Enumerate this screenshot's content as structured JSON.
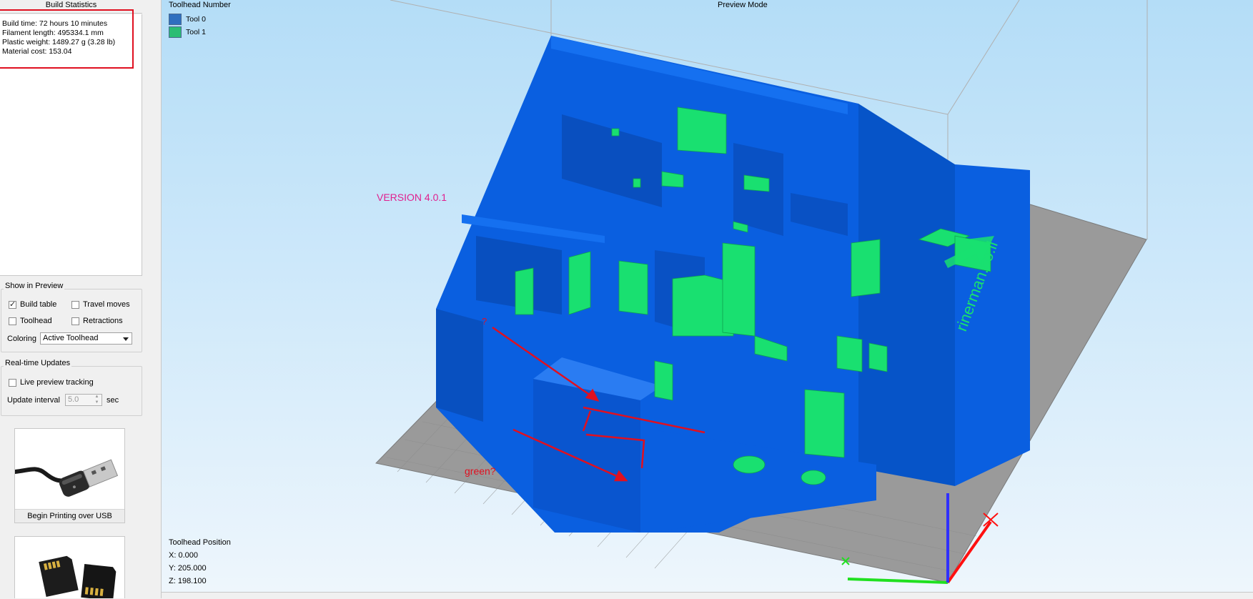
{
  "build_statistics": {
    "title": "Build Statistics",
    "build_time": "Build time: 72 hours 10 minutes",
    "filament_length": "Filament length: 495334.1 mm",
    "plastic_weight": "Plastic weight: 1489.27 g (3.28 lb)",
    "material_cost": "Material cost: 153.04"
  },
  "show_in_preview": {
    "title": "Show in Preview",
    "build_table": {
      "label": "Build table",
      "checked": true
    },
    "travel_moves": {
      "label": "Travel moves",
      "checked": false
    },
    "toolhead": {
      "label": "Toolhead",
      "checked": false
    },
    "retractions": {
      "label": "Retractions",
      "checked": false
    },
    "coloring_label": "Coloring",
    "coloring_value": "Active Toolhead"
  },
  "realtime_updates": {
    "title": "Real-time Updates",
    "live_preview": {
      "label": "Live preview tracking",
      "checked": false
    },
    "update_interval_label": "Update interval",
    "update_interval_value": "5.0",
    "update_interval_unit": "sec"
  },
  "actions": {
    "usb_label": "Begin Printing over USB"
  },
  "viewport": {
    "legend_title": "Toolhead Number",
    "tools": [
      {
        "label": "Tool 0",
        "color": "#2f6fbf"
      },
      {
        "label": "Tool 1",
        "color": "#2bbd74"
      }
    ],
    "mode_title": "Preview Mode",
    "version_text": "VERSION 4.0.1",
    "annotation_question": "?",
    "annotation_green": "green?",
    "bed_text": "rinerman.co.il",
    "toolhead_position": {
      "title": "Toolhead Position",
      "x": "X: 0.000",
      "y": "Y: 205.000",
      "z": "Z: 198.100"
    }
  },
  "colors": {
    "model_blue": "#0a5fe0",
    "model_green": "#19e070",
    "annotation_red": "#e01020",
    "bed_gray": "#9a9a9a"
  }
}
